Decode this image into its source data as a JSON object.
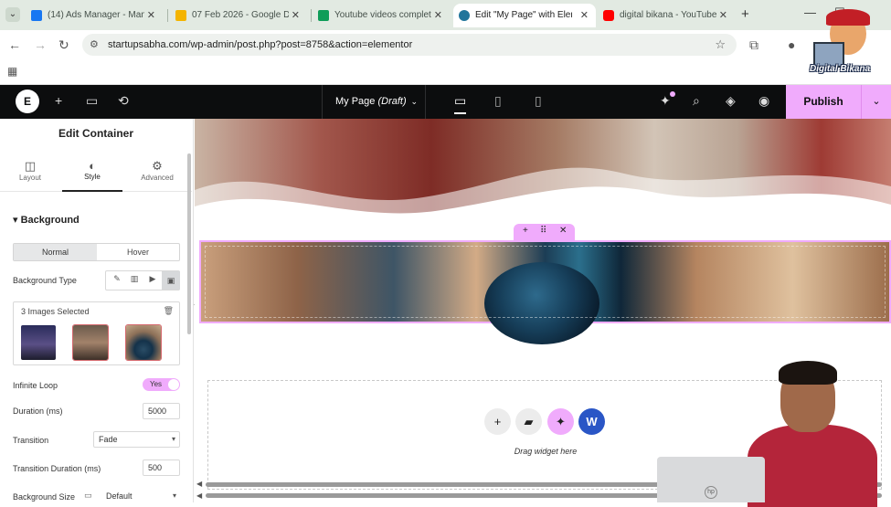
{
  "browser": {
    "tabs": [
      {
        "title": "(14) Ads Manager - Mana",
        "color": "#1877f2"
      },
      {
        "title": "07 Feb 2026 - Google Dr",
        "color": "#f4b400"
      },
      {
        "title": "Youtube videos complete",
        "color": "#0f9d58"
      },
      {
        "title": "Edit \"My Page\" with Elem",
        "color": "#21759b"
      },
      {
        "title": "digital bikana - YouTube",
        "color": "#ff0000"
      }
    ],
    "url": "startupsabha.com/wp-admin/post.php?post=8758&action=elementor"
  },
  "editor": {
    "page_name": "My Page",
    "page_status": "(Draft)",
    "publish_label": "Publish",
    "accent": "#f0abfc"
  },
  "panel": {
    "title": "Edit Container",
    "tabs": [
      {
        "label": "Layout",
        "icon": "layout-icon"
      },
      {
        "label": "Style",
        "icon": "contrast-icon"
      },
      {
        "label": "Advanced",
        "icon": "gear-icon"
      }
    ],
    "section": "Background",
    "state_normal": "Normal",
    "state_hover": "Hover",
    "background_type_label": "Background Type",
    "gallery_label": "3 Images Selected",
    "infinite_loop_label": "Infinite Loop",
    "infinite_loop_value": "Yes",
    "duration_label": "Duration (ms)",
    "duration_value": "5000",
    "transition_label": "Transition",
    "transition_value": "Fade",
    "transition_duration_label": "Transition Duration (ms)",
    "transition_duration_value": "500",
    "bg_size_label": "Background Size",
    "bg_size_value": "Default"
  },
  "canvas": {
    "drag_text": "Drag widget here"
  },
  "overlay": {
    "logo_text": "Digital Bikana"
  }
}
